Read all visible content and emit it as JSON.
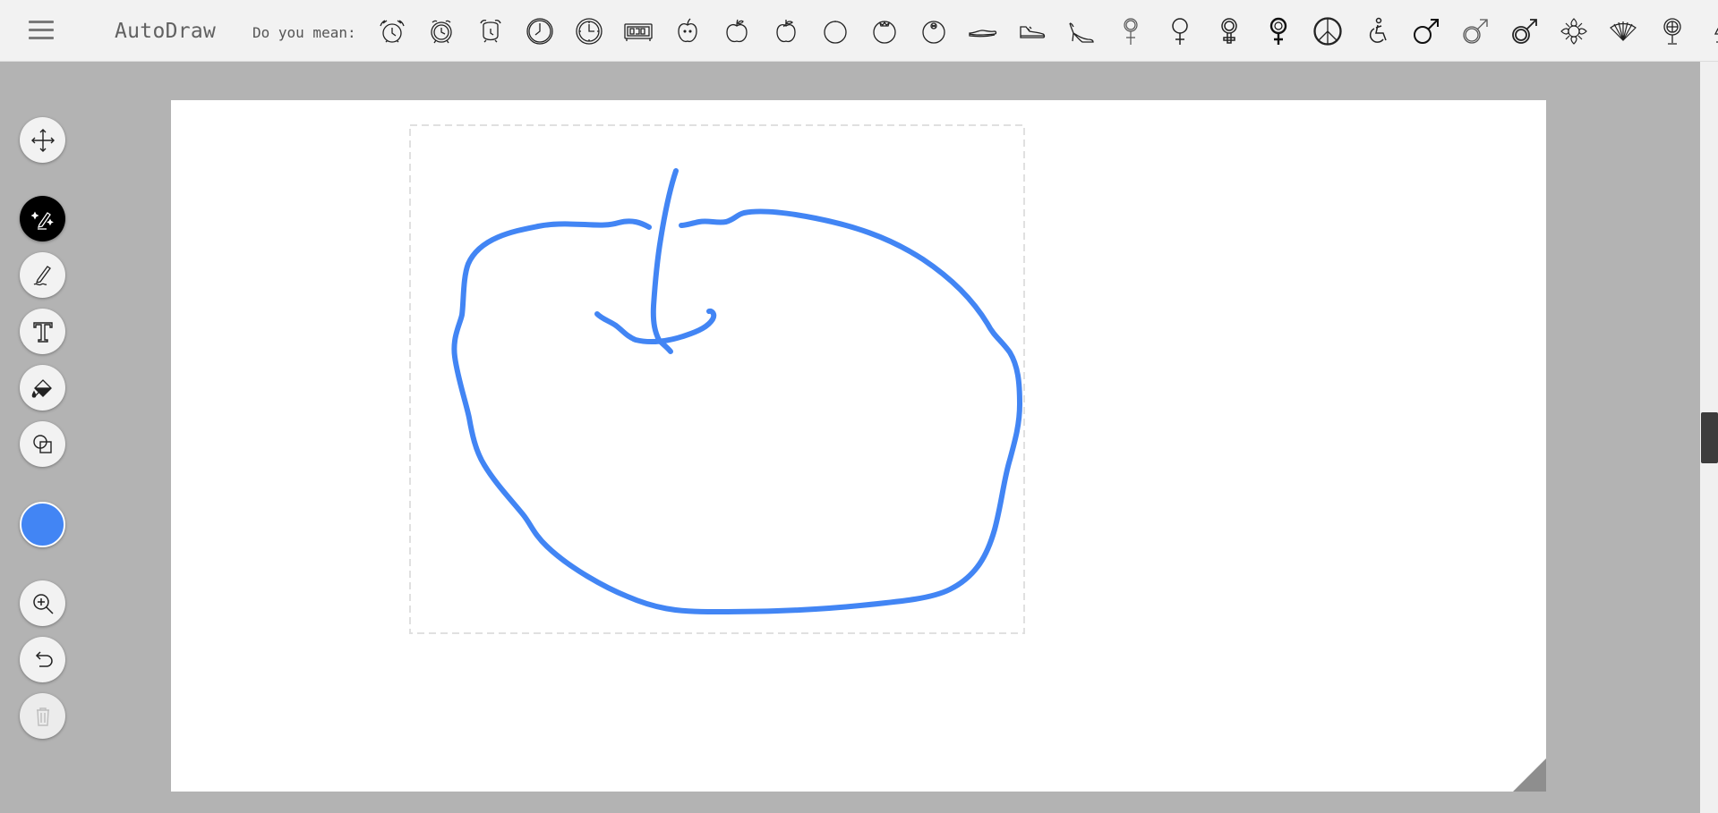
{
  "app": {
    "title": "AutoDraw"
  },
  "toolbar_top": {
    "menu_icon": "hamburger-menu-icon",
    "suggestion_label": "Do you mean:",
    "suggestions": [
      "alarm-clock-ringing",
      "alarm-clock",
      "alarm-clock-bells",
      "wall-clock",
      "clock-face",
      "digital-clock",
      "apple-with-face",
      "apple",
      "apple-leaf",
      "orange",
      "tomato",
      "melon",
      "flat-shoe",
      "sneaker",
      "high-heel-shoe",
      "female-symbol-ornate",
      "female-symbol",
      "female-symbol-double",
      "female-symbol-bold",
      "peace-sign",
      "accessibility-symbol",
      "male-symbol",
      "male-symbol-outline",
      "male-symbol-double",
      "ornament",
      "hand-fan",
      "globe-stand",
      "lamp"
    ]
  },
  "tools": [
    {
      "name": "move-tool",
      "icon": "move-arrows-icon"
    },
    {
      "name": "autodraw-tool",
      "icon": "magic-pen-icon",
      "active": true
    },
    {
      "name": "draw-tool",
      "icon": "pencil-icon"
    },
    {
      "name": "text-tool",
      "icon": "text-icon"
    },
    {
      "name": "fill-tool",
      "icon": "paint-bucket-icon"
    },
    {
      "name": "shape-tool",
      "icon": "shapes-icon"
    },
    {
      "name": "zoom-tool",
      "icon": "zoom-in-icon"
    },
    {
      "name": "undo-tool",
      "icon": "undo-icon"
    },
    {
      "name": "delete-tool",
      "icon": "trash-icon",
      "disabled": true
    }
  ],
  "colors": {
    "current": "#4285f4",
    "topbar": "#f2f2f2",
    "background": "#b3b3b3",
    "canvas": "#ffffff",
    "stroke": "#4285f4"
  }
}
